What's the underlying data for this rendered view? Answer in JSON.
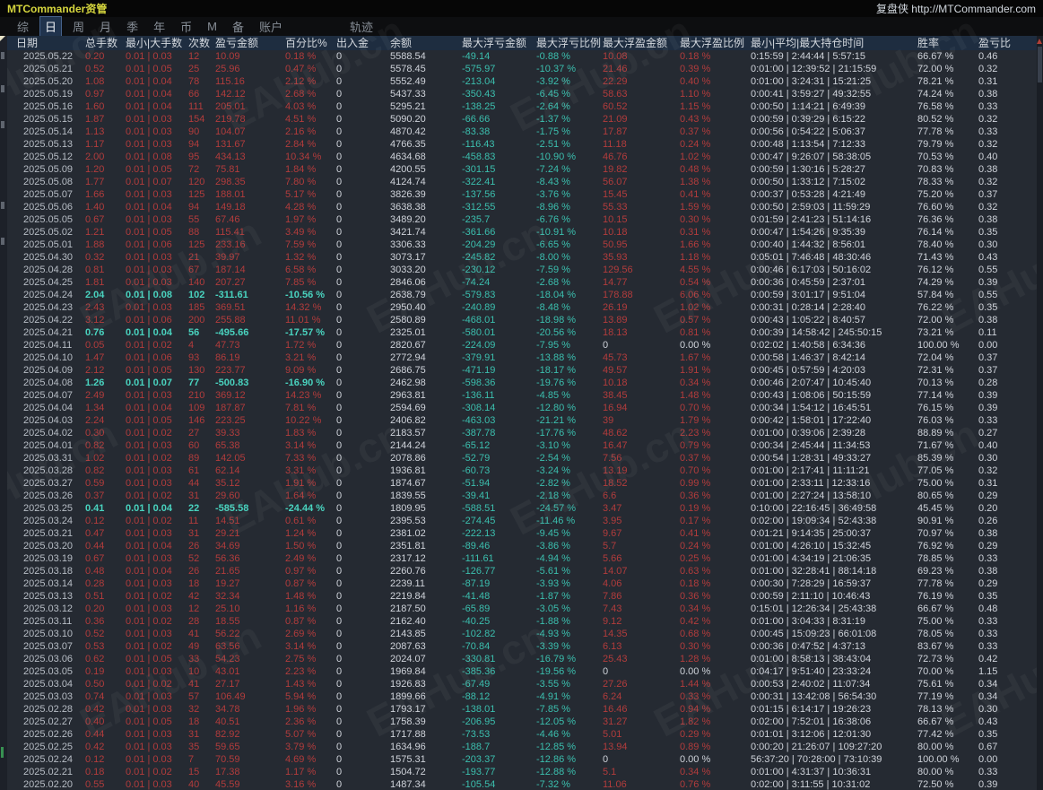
{
  "titlebar": {
    "app_title": "MTCommander资管",
    "brand": "复盘侠 http://MTCommander.com"
  },
  "tabs": {
    "items": [
      "综",
      "日",
      "周",
      "月",
      "季",
      "年",
      "币",
      "M",
      "备",
      "账户"
    ],
    "active": "日",
    "trailing": "轨迹"
  },
  "watermark_text": "EAHub.cn",
  "colors": {
    "gain_red": "#b23c3c",
    "loss_teal": "#3bbfae",
    "loss_teal_bright": "#49d3bf",
    "neutral_white": "#cfd3da",
    "date_gray": "#b7bdc5",
    "title_yellow": "#d6d63e",
    "header_bg": "#1e2d40",
    "background": "#252a32"
  },
  "table": {
    "columns": [
      "日期",
      "总手数",
      "最小|大手数",
      "次数",
      "盈亏金额",
      "百分比%",
      "出入金",
      "余额",
      "最大浮亏金额",
      "最大浮亏比例",
      "最大浮盈金额",
      "最大浮盈比例",
      "最小|平均|最大持仓时间",
      "胜率",
      "盈亏比"
    ],
    "rows": [
      [
        "2025.05.22",
        "0.20",
        "0.01 | 0.03",
        "12",
        "10.09",
        "0.18 %",
        "0",
        "5588.54",
        "-49.14",
        "-0.88 %",
        "10.08",
        "0.18 %",
        "0:15:59 | 2:44:44 | 5:57:15",
        "66.67 %",
        "0.46"
      ],
      [
        "2025.05.21",
        "0.52",
        "0.01 | 0.05",
        "25",
        "25.96",
        "0.47 %",
        "0",
        "5578.45",
        "-575.97",
        "-10.37 %",
        "21.46",
        "0.39 %",
        "0:01:00 | 12:39:52 | 21:15:59",
        "72.00 %",
        "0.32"
      ],
      [
        "2025.05.20",
        "1.08",
        "0.01 | 0.04",
        "78",
        "115.16",
        "2.12 %",
        "0",
        "5552.49",
        "-213.04",
        "-3.92 %",
        "22.29",
        "0.40 %",
        "0:01:00 | 3:24:31 | 15:21:25",
        "78.21 %",
        "0.31"
      ],
      [
        "2025.05.19",
        "0.97",
        "0.01 | 0.04",
        "66",
        "142.12",
        "2.68 %",
        "0",
        "5437.33",
        "-350.43",
        "-6.45 %",
        "58.63",
        "1.10 %",
        "0:00:41 | 3:59:27 | 49:32:55",
        "74.24 %",
        "0.38"
      ],
      [
        "2025.05.16",
        "1.60",
        "0.01 | 0.04",
        "111",
        "205.01",
        "4.03 %",
        "0",
        "5295.21",
        "-138.25",
        "-2.64 %",
        "60.52",
        "1.15 %",
        "0:00:50 | 1:14:21 | 6:49:39",
        "76.58 %",
        "0.33"
      ],
      [
        "2025.05.15",
        "1.87",
        "0.01 | 0.03",
        "154",
        "219.78",
        "4.51 %",
        "0",
        "5090.20",
        "-66.66",
        "-1.37 %",
        "21.09",
        "0.43 %",
        "0:00:59 | 0:39:29 | 6:15:22",
        "80.52 %",
        "0.32"
      ],
      [
        "2025.05.14",
        "1.13",
        "0.01 | 0.03",
        "90",
        "104.07",
        "2.16 %",
        "0",
        "4870.42",
        "-83.38",
        "-1.75 %",
        "17.87",
        "0.37 %",
        "0:00:56 | 0:54:22 | 5:06:37",
        "77.78 %",
        "0.33"
      ],
      [
        "2025.05.13",
        "1.17",
        "0.01 | 0.03",
        "94",
        "131.67",
        "2.84 %",
        "0",
        "4766.35",
        "-116.43",
        "-2.51 %",
        "11.18",
        "0.24 %",
        "0:00:48 | 1:13:54 | 7:12:33",
        "79.79 %",
        "0.32"
      ],
      [
        "2025.05.12",
        "2.00",
        "0.01 | 0.08",
        "95",
        "434.13",
        "10.34 %",
        "0",
        "4634.68",
        "-458.83",
        "-10.90 %",
        "46.76",
        "1.02 %",
        "0:00:47 | 9:26:07 | 58:38:05",
        "70.53 %",
        "0.40"
      ],
      [
        "2025.05.09",
        "1.20",
        "0.01 | 0.05",
        "72",
        "75.81",
        "1.84 %",
        "0",
        "4200.55",
        "-301.15",
        "-7.24 %",
        "19.82",
        "0.48 %",
        "0:00:59 | 1:30:16 | 5:28:27",
        "70.83 %",
        "0.38"
      ],
      [
        "2025.05.08",
        "1.77",
        "0.01 | 0.07",
        "120",
        "298.35",
        "7.80 %",
        "0",
        "4124.74",
        "-322.41",
        "-8.43 %",
        "56.07",
        "1.38 %",
        "0:00:50 | 1:33:12 | 7:15:02",
        "78.33 %",
        "0.32"
      ],
      [
        "2025.05.07",
        "1.66",
        "0.01 | 0.03",
        "125",
        "188.01",
        "5.17 %",
        "0",
        "3826.39",
        "-137.56",
        "-3.76 %",
        "15.45",
        "0.41 %",
        "0:00:37 | 0:53:28 | 4:21:49",
        "75.20 %",
        "0.37"
      ],
      [
        "2025.05.06",
        "1.40",
        "0.01 | 0.04",
        "94",
        "149.18",
        "4.28 %",
        "0",
        "3638.38",
        "-312.55",
        "-8.96 %",
        "55.33",
        "1.59 %",
        "0:00:50 | 2:59:03 | 11:59:29",
        "76.60 %",
        "0.32"
      ],
      [
        "2025.05.05",
        "0.67",
        "0.01 | 0.03",
        "55",
        "67.46",
        "1.97 %",
        "0",
        "3489.20",
        "-235.7",
        "-6.76 %",
        "10.15",
        "0.30 %",
        "0:01:59 | 2:41:23 | 51:14:16",
        "76.36 %",
        "0.38"
      ],
      [
        "2025.05.02",
        "1.21",
        "0.01 | 0.05",
        "88",
        "115.41",
        "3.49 %",
        "0",
        "3421.74",
        "-361.66",
        "-10.91 %",
        "10.18",
        "0.31 %",
        "0:00:47 | 1:54:26 | 9:35:39",
        "76.14 %",
        "0.35"
      ],
      [
        "2025.05.01",
        "1.88",
        "0.01 | 0.06",
        "125",
        "233.16",
        "7.59 %",
        "0",
        "3306.33",
        "-204.29",
        "-6.65 %",
        "50.95",
        "1.66 %",
        "0:00:40 | 1:44:32 | 8:56:01",
        "78.40 %",
        "0.30"
      ],
      [
        "2025.04.30",
        "0.32",
        "0.01 | 0.03",
        "21",
        "39.97",
        "1.32 %",
        "0",
        "3073.17",
        "-245.82",
        "-8.00 %",
        "35.93",
        "1.18 %",
        "0:05:01 | 7:46:48 | 48:30:46",
        "71.43 %",
        "0.43"
      ],
      [
        "2025.04.28",
        "0.81",
        "0.01 | 0.03",
        "67",
        "187.14",
        "6.58 %",
        "0",
        "3033.20",
        "-230.12",
        "-7.59 %",
        "129.56",
        "4.55 %",
        "0:00:46 | 6:17:03 | 50:16:02",
        "76.12 %",
        "0.55"
      ],
      [
        "2025.04.25",
        "1.81",
        "0.01 | 0.03",
        "140",
        "207.27",
        "7.85 %",
        "0",
        "2846.06",
        "-74.24",
        "-2.68 %",
        "14.77",
        "0.54 %",
        "0:00:36 | 0:45:59 | 2:37:01",
        "74.29 %",
        "0.39"
      ],
      [
        "2025.04.24",
        "2.04",
        "0.01 | 0.08",
        "102",
        "-311.61",
        "-10.56 %",
        "0",
        "2638.79",
        "-579.83",
        "-18.04 %",
        "178.88",
        "6.06 %",
        "0:00:59 | 3:01:17 | 9:51:04",
        "57.84 %",
        "0.55"
      ],
      [
        "2025.04.23",
        "2.43",
        "0.01 | 0.03",
        "185",
        "369.51",
        "14.32 %",
        "0",
        "2950.40",
        "-240.89",
        "-8.48 %",
        "26.19",
        "1.02 %",
        "0:00:31 | 0:28:14 | 2:28:40",
        "76.22 %",
        "0.35"
      ],
      [
        "2025.04.22",
        "3.12",
        "0.01 | 0.06",
        "200",
        "255.88",
        "11.01 %",
        "0",
        "2580.89",
        "-468.01",
        "-18.98 %",
        "13.89",
        "0.57 %",
        "0:00:43 | 1:05:22 | 8:40:57",
        "72.00 %",
        "0.38"
      ],
      [
        "2025.04.21",
        "0.76",
        "0.01 | 0.04",
        "56",
        "-495.66",
        "-17.57 %",
        "0",
        "2325.01",
        "-580.01",
        "-20.56 %",
        "18.13",
        "0.81 %",
        "0:00:39 | 14:58:42 | 245:50:15",
        "73.21 %",
        "0.11"
      ],
      [
        "2025.04.11",
        "0.05",
        "0.01 | 0.02",
        "4",
        "47.73",
        "1.72 %",
        "0",
        "2820.67",
        "-224.09",
        "-7.95 %",
        "0",
        "0.00 %",
        "0:02:02 | 1:40:58 | 6:34:36",
        "100.00 %",
        "0.00"
      ],
      [
        "2025.04.10",
        "1.47",
        "0.01 | 0.06",
        "93",
        "86.19",
        "3.21 %",
        "0",
        "2772.94",
        "-379.91",
        "-13.88 %",
        "45.73",
        "1.67 %",
        "0:00:58 | 1:46:37 | 8:42:14",
        "72.04 %",
        "0.37"
      ],
      [
        "2025.04.09",
        "2.12",
        "0.01 | 0.05",
        "130",
        "223.77",
        "9.09 %",
        "0",
        "2686.75",
        "-471.19",
        "-18.17 %",
        "49.57",
        "1.91 %",
        "0:00:45 | 0:57:59 | 4:20:03",
        "72.31 %",
        "0.37"
      ],
      [
        "2025.04.08",
        "1.26",
        "0.01 | 0.07",
        "77",
        "-500.83",
        "-16.90 %",
        "0",
        "2462.98",
        "-598.36",
        "-19.76 %",
        "10.18",
        "0.34 %",
        "0:00:46 | 2:07:47 | 10:45:40",
        "70.13 %",
        "0.28"
      ],
      [
        "2025.04.07",
        "2.49",
        "0.01 | 0.03",
        "210",
        "369.12",
        "14.23 %",
        "0",
        "2963.81",
        "-136.11",
        "-4.85 %",
        "38.45",
        "1.48 %",
        "0:00:43 | 1:08:06 | 50:15:59",
        "77.14 %",
        "0.39"
      ],
      [
        "2025.04.04",
        "1.34",
        "0.01 | 0.04",
        "109",
        "187.87",
        "7.81 %",
        "0",
        "2594.69",
        "-308.14",
        "-12.80 %",
        "16.94",
        "0.70 %",
        "0:00:34 | 1:54:12 | 16:45:51",
        "76.15 %",
        "0.39"
      ],
      [
        "2025.04.03",
        "2.24",
        "0.01 | 0.05",
        "146",
        "223.25",
        "10.22 %",
        "0",
        "2406.82",
        "-463.03",
        "-21.21 %",
        "39",
        "1.79 %",
        "0:00:42 | 1:58:01 | 17:22:40",
        "76.03 %",
        "0.33"
      ],
      [
        "2025.04.02",
        "0.30",
        "0.01 | 0.02",
        "27",
        "39.33",
        "1.83 %",
        "0",
        "2183.57",
        "-387.78",
        "-17.76 %",
        "48.62",
        "2.23 %",
        "0:01:00 | 0:39:06 | 2:39:28",
        "88.89 %",
        "0.27"
      ],
      [
        "2025.04.01",
        "0.82",
        "0.01 | 0.03",
        "60",
        "65.38",
        "3.14 %",
        "0",
        "2144.24",
        "-65.12",
        "-3.10 %",
        "16.47",
        "0.79 %",
        "0:00:34 | 2:45:44 | 11:34:53",
        "71.67 %",
        "0.40"
      ],
      [
        "2025.03.31",
        "1.02",
        "0.01 | 0.02",
        "89",
        "142.05",
        "7.33 %",
        "0",
        "2078.86",
        "-52.79",
        "-2.54 %",
        "7.56",
        "0.37 %",
        "0:00:54 | 1:28:31 | 49:33:27",
        "85.39 %",
        "0.30"
      ],
      [
        "2025.03.28",
        "0.82",
        "0.01 | 0.03",
        "61",
        "62.14",
        "3.31 %",
        "0",
        "1936.81",
        "-60.73",
        "-3.24 %",
        "13.19",
        "0.70 %",
        "0:01:00 | 2:17:41 | 11:11:21",
        "77.05 %",
        "0.32"
      ],
      [
        "2025.03.27",
        "0.59",
        "0.01 | 0.03",
        "44",
        "35.12",
        "1.91 %",
        "0",
        "1874.67",
        "-51.94",
        "-2.82 %",
        "18.52",
        "0.99 %",
        "0:01:00 | 2:33:11 | 12:33:16",
        "75.00 %",
        "0.31"
      ],
      [
        "2025.03.26",
        "0.37",
        "0.01 | 0.02",
        "31",
        "29.60",
        "1.64 %",
        "0",
        "1839.55",
        "-39.41",
        "-2.18 %",
        "6.6",
        "0.36 %",
        "0:01:00 | 2:27:24 | 13:58:10",
        "80.65 %",
        "0.29"
      ],
      [
        "2025.03.25",
        "0.41",
        "0.01 | 0.04",
        "22",
        "-585.58",
        "-24.44 %",
        "0",
        "1809.95",
        "-588.51",
        "-24.57 %",
        "3.47",
        "0.19 %",
        "0:10:00 | 22:16:45 | 36:49:58",
        "45.45 %",
        "0.20"
      ],
      [
        "2025.03.24",
        "0.12",
        "0.01 | 0.02",
        "11",
        "14.51",
        "0.61 %",
        "0",
        "2395.53",
        "-274.45",
        "-11.46 %",
        "3.95",
        "0.17 %",
        "0:02:00 | 19:09:34 | 52:43:38",
        "90.91 %",
        "0.26"
      ],
      [
        "2025.03.21",
        "0.47",
        "0.01 | 0.03",
        "31",
        "29.21",
        "1.24 %",
        "0",
        "2381.02",
        "-222.13",
        "-9.45 %",
        "9.67",
        "0.41 %",
        "0:01:21 | 9:14:35 | 25:00:37",
        "70.97 %",
        "0.38"
      ],
      [
        "2025.03.20",
        "0.44",
        "0.01 | 0.04",
        "26",
        "34.69",
        "1.50 %",
        "0",
        "2351.81",
        "-89.46",
        "-3.86 %",
        "5.7",
        "0.24 %",
        "0:01:00 | 4:26:10 | 15:32:45",
        "76.92 %",
        "0.29"
      ],
      [
        "2025.03.19",
        "0.67",
        "0.01 | 0.03",
        "52",
        "56.36",
        "2.49 %",
        "0",
        "2317.12",
        "-111.61",
        "-4.94 %",
        "5.66",
        "0.25 %",
        "0:01:00 | 4:34:19 | 21:06:35",
        "78.85 %",
        "0.33"
      ],
      [
        "2025.03.18",
        "0.48",
        "0.01 | 0.04",
        "26",
        "21.65",
        "0.97 %",
        "0",
        "2260.76",
        "-126.77",
        "-5.61 %",
        "14.07",
        "0.63 %",
        "0:01:00 | 32:28:41 | 88:14:18",
        "69.23 %",
        "0.38"
      ],
      [
        "2025.03.14",
        "0.28",
        "0.01 | 0.03",
        "18",
        "19.27",
        "0.87 %",
        "0",
        "2239.11",
        "-87.19",
        "-3.93 %",
        "4.06",
        "0.18 %",
        "0:00:30 | 7:28:29 | 16:59:37",
        "77.78 %",
        "0.29"
      ],
      [
        "2025.03.13",
        "0.51",
        "0.01 | 0.02",
        "42",
        "32.34",
        "1.48 %",
        "0",
        "2219.84",
        "-41.48",
        "-1.87 %",
        "7.86",
        "0.36 %",
        "0:00:59 | 2:11:10 | 10:46:43",
        "76.19 %",
        "0.35"
      ],
      [
        "2025.03.12",
        "0.20",
        "0.01 | 0.03",
        "12",
        "25.10",
        "1.16 %",
        "0",
        "2187.50",
        "-65.89",
        "-3.05 %",
        "7.43",
        "0.34 %",
        "0:15:01 | 12:26:34 | 25:43:38",
        "66.67 %",
        "0.48"
      ],
      [
        "2025.03.11",
        "0.36",
        "0.01 | 0.02",
        "28",
        "18.55",
        "0.87 %",
        "0",
        "2162.40",
        "-40.25",
        "-1.88 %",
        "9.12",
        "0.42 %",
        "0:01:00 | 3:04:33 | 8:31:19",
        "75.00 %",
        "0.33"
      ],
      [
        "2025.03.10",
        "0.52",
        "0.01 | 0.03",
        "41",
        "56.22",
        "2.69 %",
        "0",
        "2143.85",
        "-102.82",
        "-4.93 %",
        "14.35",
        "0.68 %",
        "0:00:45 | 15:09:23 | 66:01:08",
        "78.05 %",
        "0.33"
      ],
      [
        "2025.03.07",
        "0.53",
        "0.01 | 0.02",
        "49",
        "63.56",
        "3.14 %",
        "0",
        "2087.63",
        "-70.84",
        "-3.39 %",
        "6.13",
        "0.30 %",
        "0:00:36 | 0:47:52 | 4:37:13",
        "83.67 %",
        "0.33"
      ],
      [
        "2025.03.06",
        "0.62",
        "0.01 | 0.05",
        "33",
        "54.23",
        "2.75 %",
        "0",
        "2024.07",
        "-330.81",
        "-16.79 %",
        "25.43",
        "1.28 %",
        "0:01:00 | 8:58:13 | 38:43:04",
        "72.73 %",
        "0.42"
      ],
      [
        "2025.03.05",
        "0.19",
        "0.01 | 0.03",
        "10",
        "43.01",
        "2.23 %",
        "0",
        "1969.84",
        "-385.36",
        "-19.56 %",
        "0",
        "0.00 %",
        "0:04:17 | 9:51:40 | 23:33:24",
        "70.00 %",
        "1.15"
      ],
      [
        "2025.03.04",
        "0.50",
        "0.01 | 0.02",
        "41",
        "27.17",
        "1.43 %",
        "0",
        "1926.83",
        "-67.49",
        "-3.55 %",
        "27.26",
        "1.44 %",
        "0:00:53 | 2:40:02 | 11:07:34",
        "75.61 %",
        "0.34"
      ],
      [
        "2025.03.03",
        "0.74",
        "0.01 | 0.03",
        "57",
        "106.49",
        "5.94 %",
        "0",
        "1899.66",
        "-88.12",
        "-4.91 %",
        "6.24",
        "0.33 %",
        "0:00:31 | 13:42:08 | 56:54:30",
        "77.19 %",
        "0.34"
      ],
      [
        "2025.02.28",
        "0.42",
        "0.01 | 0.03",
        "32",
        "34.78",
        "1.96 %",
        "0",
        "1793.17",
        "-138.01",
        "-7.85 %",
        "16.46",
        "0.94 %",
        "0:01:15 | 6:14:17 | 19:26:23",
        "78.13 %",
        "0.30"
      ],
      [
        "2025.02.27",
        "0.40",
        "0.01 | 0.05",
        "18",
        "40.51",
        "2.36 %",
        "0",
        "1758.39",
        "-206.95",
        "-12.05 %",
        "31.27",
        "1.82 %",
        "0:02:00 | 7:52:01 | 16:38:06",
        "66.67 %",
        "0.43"
      ],
      [
        "2025.02.26",
        "0.44",
        "0.01 | 0.03",
        "31",
        "82.92",
        "5.07 %",
        "0",
        "1717.88",
        "-73.53",
        "-4.46 %",
        "5.01",
        "0.29 %",
        "0:01:01 | 3:12:06 | 12:01:30",
        "77.42 %",
        "0.35"
      ],
      [
        "2025.02.25",
        "0.42",
        "0.01 | 0.03",
        "35",
        "59.65",
        "3.79 %",
        "0",
        "1634.96",
        "-188.7",
        "-12.85 %",
        "13.94",
        "0.89 %",
        "0:00:20 | 21:26:07 | 109:27:20",
        "80.00 %",
        "0.67"
      ],
      [
        "2025.02.24",
        "0.12",
        "0.01 | 0.03",
        "7",
        "70.59",
        "4.69 %",
        "0",
        "1575.31",
        "-203.37",
        "-12.86 %",
        "0",
        "0.00 %",
        "56:37:20 | 70:28:00 | 73:10:39",
        "100.00 %",
        "0.00"
      ],
      [
        "2025.02.21",
        "0.18",
        "0.01 | 0.02",
        "15",
        "17.38",
        "1.17 %",
        "0",
        "1504.72",
        "-193.77",
        "-12.88 %",
        "5.1",
        "0.34 %",
        "0:01:00 | 4:31:37 | 10:36:31",
        "80.00 %",
        "0.33"
      ],
      [
        "2025.02.20",
        "0.55",
        "0.01 | 0.03",
        "40",
        "45.59",
        "3.16 %",
        "0",
        "1487.34",
        "-105.54",
        "-7.32 %",
        "11.06",
        "0.76 %",
        "0:02:00 | 3:11:55 | 10:31:02",
        "72.50 %",
        "0.39"
      ]
    ]
  }
}
